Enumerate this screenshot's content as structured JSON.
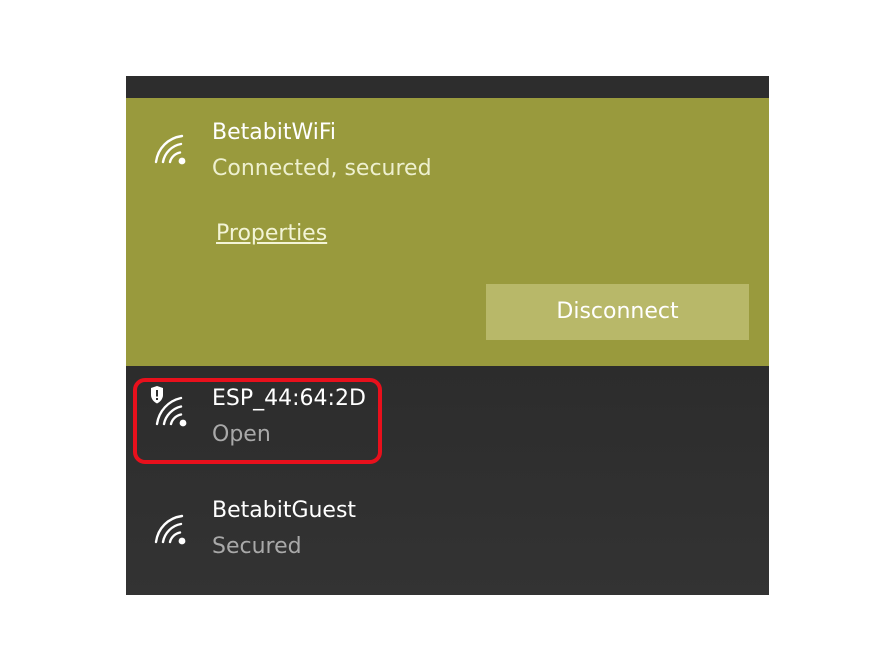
{
  "connected_network": {
    "name": "BetabitWiFi",
    "status": "Connected, secured",
    "properties_label": "Properties",
    "disconnect_label": "Disconnect",
    "icon": "wifi-signal-icon",
    "background_color": "#999a3d"
  },
  "networks": [
    {
      "name": "ESP_44:64:2D",
      "status": "Open",
      "icon": "wifi-open-warning-icon",
      "highlighted": true
    },
    {
      "name": "BetabitGuest",
      "status": "Secured",
      "icon": "wifi-signal-icon",
      "highlighted": false
    }
  ],
  "colors": {
    "panel_background": "#2e2e2e",
    "highlight_border": "#e8101c",
    "button_background": "#b8b869"
  }
}
